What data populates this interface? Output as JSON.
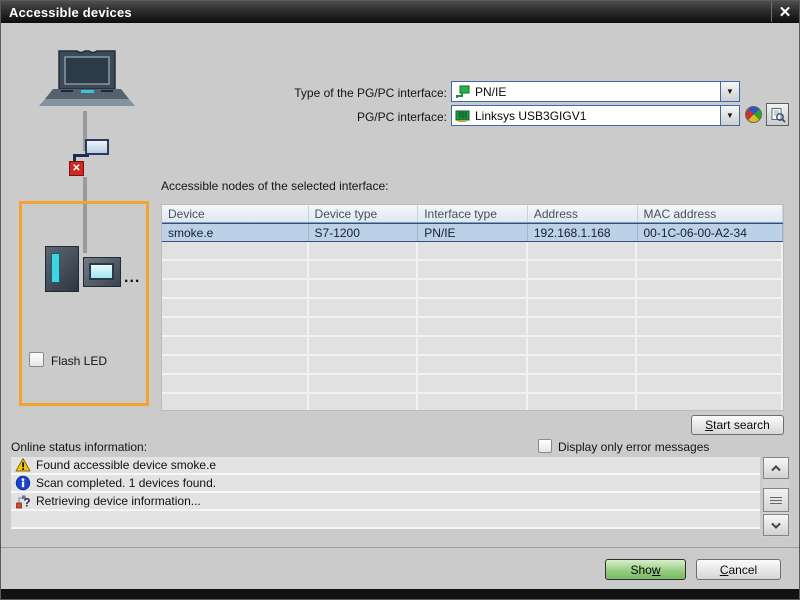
{
  "window": {
    "title": "Accessible devices",
    "close_glyph": "✕"
  },
  "interface_section": {
    "type_label": "Type of the PG/PC interface:",
    "type_value": "PN/IE",
    "type_icon": "pnie-node-icon",
    "pgpc_label": "PG/PC interface:",
    "pgpc_value": "Linksys USB3GIGV1",
    "pgpc_icon": "network-card-icon"
  },
  "nodes_section": {
    "label": "Accessible nodes of the selected interface:",
    "columns": [
      "Device",
      "Device type",
      "Interface type",
      "Address",
      "MAC address"
    ],
    "rows": [
      [
        "smoke.e",
        "S7-1200",
        "PN/IE",
        "192.168.1.168",
        "00-1C-06-00-A2-34"
      ]
    ],
    "empty_row_count": 10
  },
  "left_panel": {
    "flash_led_label": "Flash LED",
    "flash_led_checked": false,
    "ellipsis": "..."
  },
  "buttons": {
    "start_search": {
      "pre": "",
      "underline": "S",
      "post": "tart search"
    },
    "show": {
      "pre": "Sho",
      "underline": "w",
      "post": ""
    },
    "cancel": {
      "pre": "",
      "underline": "C",
      "post": "ancel"
    }
  },
  "status_section": {
    "label": "Online status information:",
    "filter_label": "Display only error messages",
    "filter_checked": false,
    "messages": [
      {
        "icon": "warning",
        "text": "Found accessible device smoke.e"
      },
      {
        "icon": "info",
        "text": "Scan completed. 1 devices found."
      },
      {
        "icon": "retrieving",
        "text": "Retrieving device information..."
      }
    ],
    "empty_row_count": 1
  },
  "colors": {
    "accent_orange": "#F2A331",
    "selection_blue": "#BCD1E8",
    "show_green": "#8CC878",
    "combo_border": "#3F69A5",
    "title_bar": "#1A1A1A"
  }
}
